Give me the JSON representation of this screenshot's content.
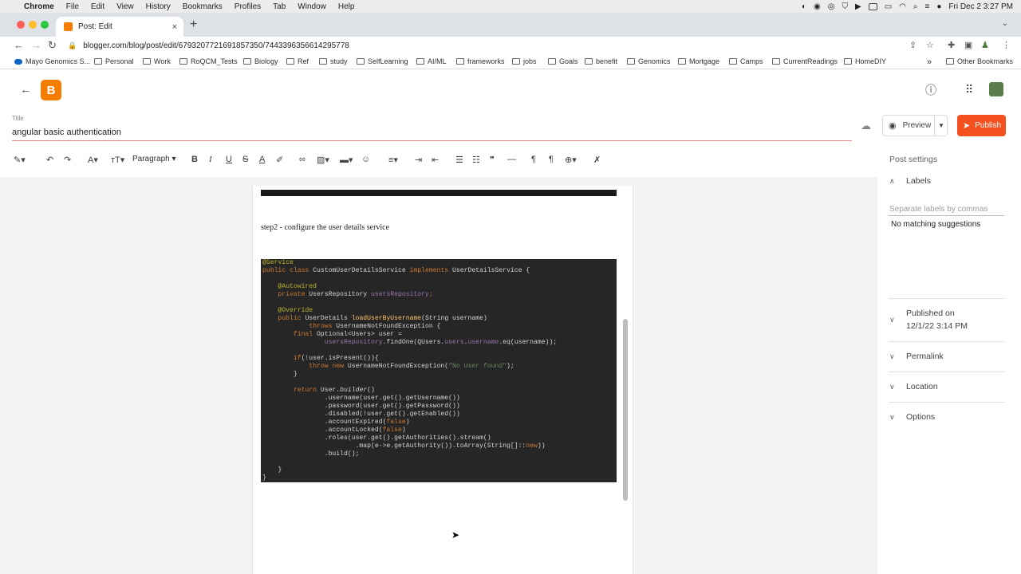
{
  "menubar": {
    "app": "Chrome",
    "items": [
      "File",
      "Edit",
      "View",
      "History",
      "Bookmarks",
      "Profiles",
      "Tab",
      "Window",
      "Help"
    ],
    "clock": "Fri Dec 2  3:27 PM"
  },
  "tab": {
    "title": "Post: Edit",
    "close": "×",
    "new": "+"
  },
  "address": {
    "url": "blogger.com/blog/post/edit/6793207721691857350/7443396356614295778"
  },
  "bookmarks": {
    "items": [
      "Mayo Genomics S...",
      "Personal",
      "Work",
      "RoQCM_Tests",
      "Biology",
      "Ref",
      "study",
      "SelfLearning",
      "AI/ML",
      "frameworks",
      "jobs",
      "Goals",
      "benefit",
      "Genomics",
      "Mortgage",
      "Camps",
      "CurrentReadings",
      "HomeDIY"
    ],
    "more": "»",
    "other": "Other Bookmarks"
  },
  "blogger": {
    "logo": "B"
  },
  "post": {
    "title_label": "Title",
    "title_value": "angular basic authentication",
    "preview_label": "Preview",
    "publish_label": "Publish"
  },
  "editor": {
    "paragraph_label": "Paragraph",
    "step2_text": "step2 - configure the user details service"
  },
  "sidebar": {
    "post_settings": "Post settings",
    "labels": "Labels",
    "labels_placeholder": "Separate labels by commas",
    "no_matching": "No matching suggestions",
    "published_on": "Published on",
    "published_date": "12/1/22 3:14 PM",
    "permalink": "Permalink",
    "location": "Location",
    "options": "Options"
  },
  "code": {
    "l01": "@Service",
    "l02a": "public class ",
    "l02b": "CustomUserDetailsService ",
    "l02c": "implements ",
    "l02d": "UserDetailsService {",
    "l04": "    @Autowired",
    "l05a": "    private ",
    "l05b": "UsersRepository ",
    "l05c": "usersRepository",
    "l05d": ";",
    "l07": "    @Override",
    "l08a": "    public ",
    "l08b": "UserDetails ",
    "l08c": "loadUserByUsername",
    "l08d": "(String username)",
    "l09a": "            throws ",
    "l09b": "UsernameNotFoundException {",
    "l10a": "        final ",
    "l10b": "Optional<Users> user =",
    "l11a": "                usersRepository",
    "l11b": ".findOne(QUsers.",
    "l11c": "users",
    "l11d": ".",
    "l11e": "username",
    "l11f": ".eq(username));",
    "l13a": "        if",
    "l13b": "(!user.isPresent()){",
    "l14a": "            throw new ",
    "l14b": "UsernameNotFoundException(",
    "l14c": "\"No User found\"",
    "l14d": ");",
    "l15": "        }",
    "l17a": "        return ",
    "l17b": "User.",
    "l17c": "builder",
    "l17d": "()",
    "l18": "                .username(user.get().getUsername())",
    "l19": "                .password(user.get().getPassword())",
    "l20": "                .disabled(!user.get().getEnabled())",
    "l21a": "                .accountExpired(",
    "l21b": "false",
    "l21c": ")",
    "l22a": "                .accountLocked(",
    "l22b": "false",
    "l22c": ")",
    "l23": "                .roles(user.get().getAuthorities().stream()",
    "l24a": "                        .map(e->e.getAuthority()).toArray(String[]::",
    "l24b": "new",
    "l24c": "))",
    "l25": "                .build();",
    "l27": "    }",
    "l28": "}"
  },
  "colors": {
    "publish": "#f4511e",
    "blogger": "#f57d00",
    "code_bg": "#262626"
  }
}
